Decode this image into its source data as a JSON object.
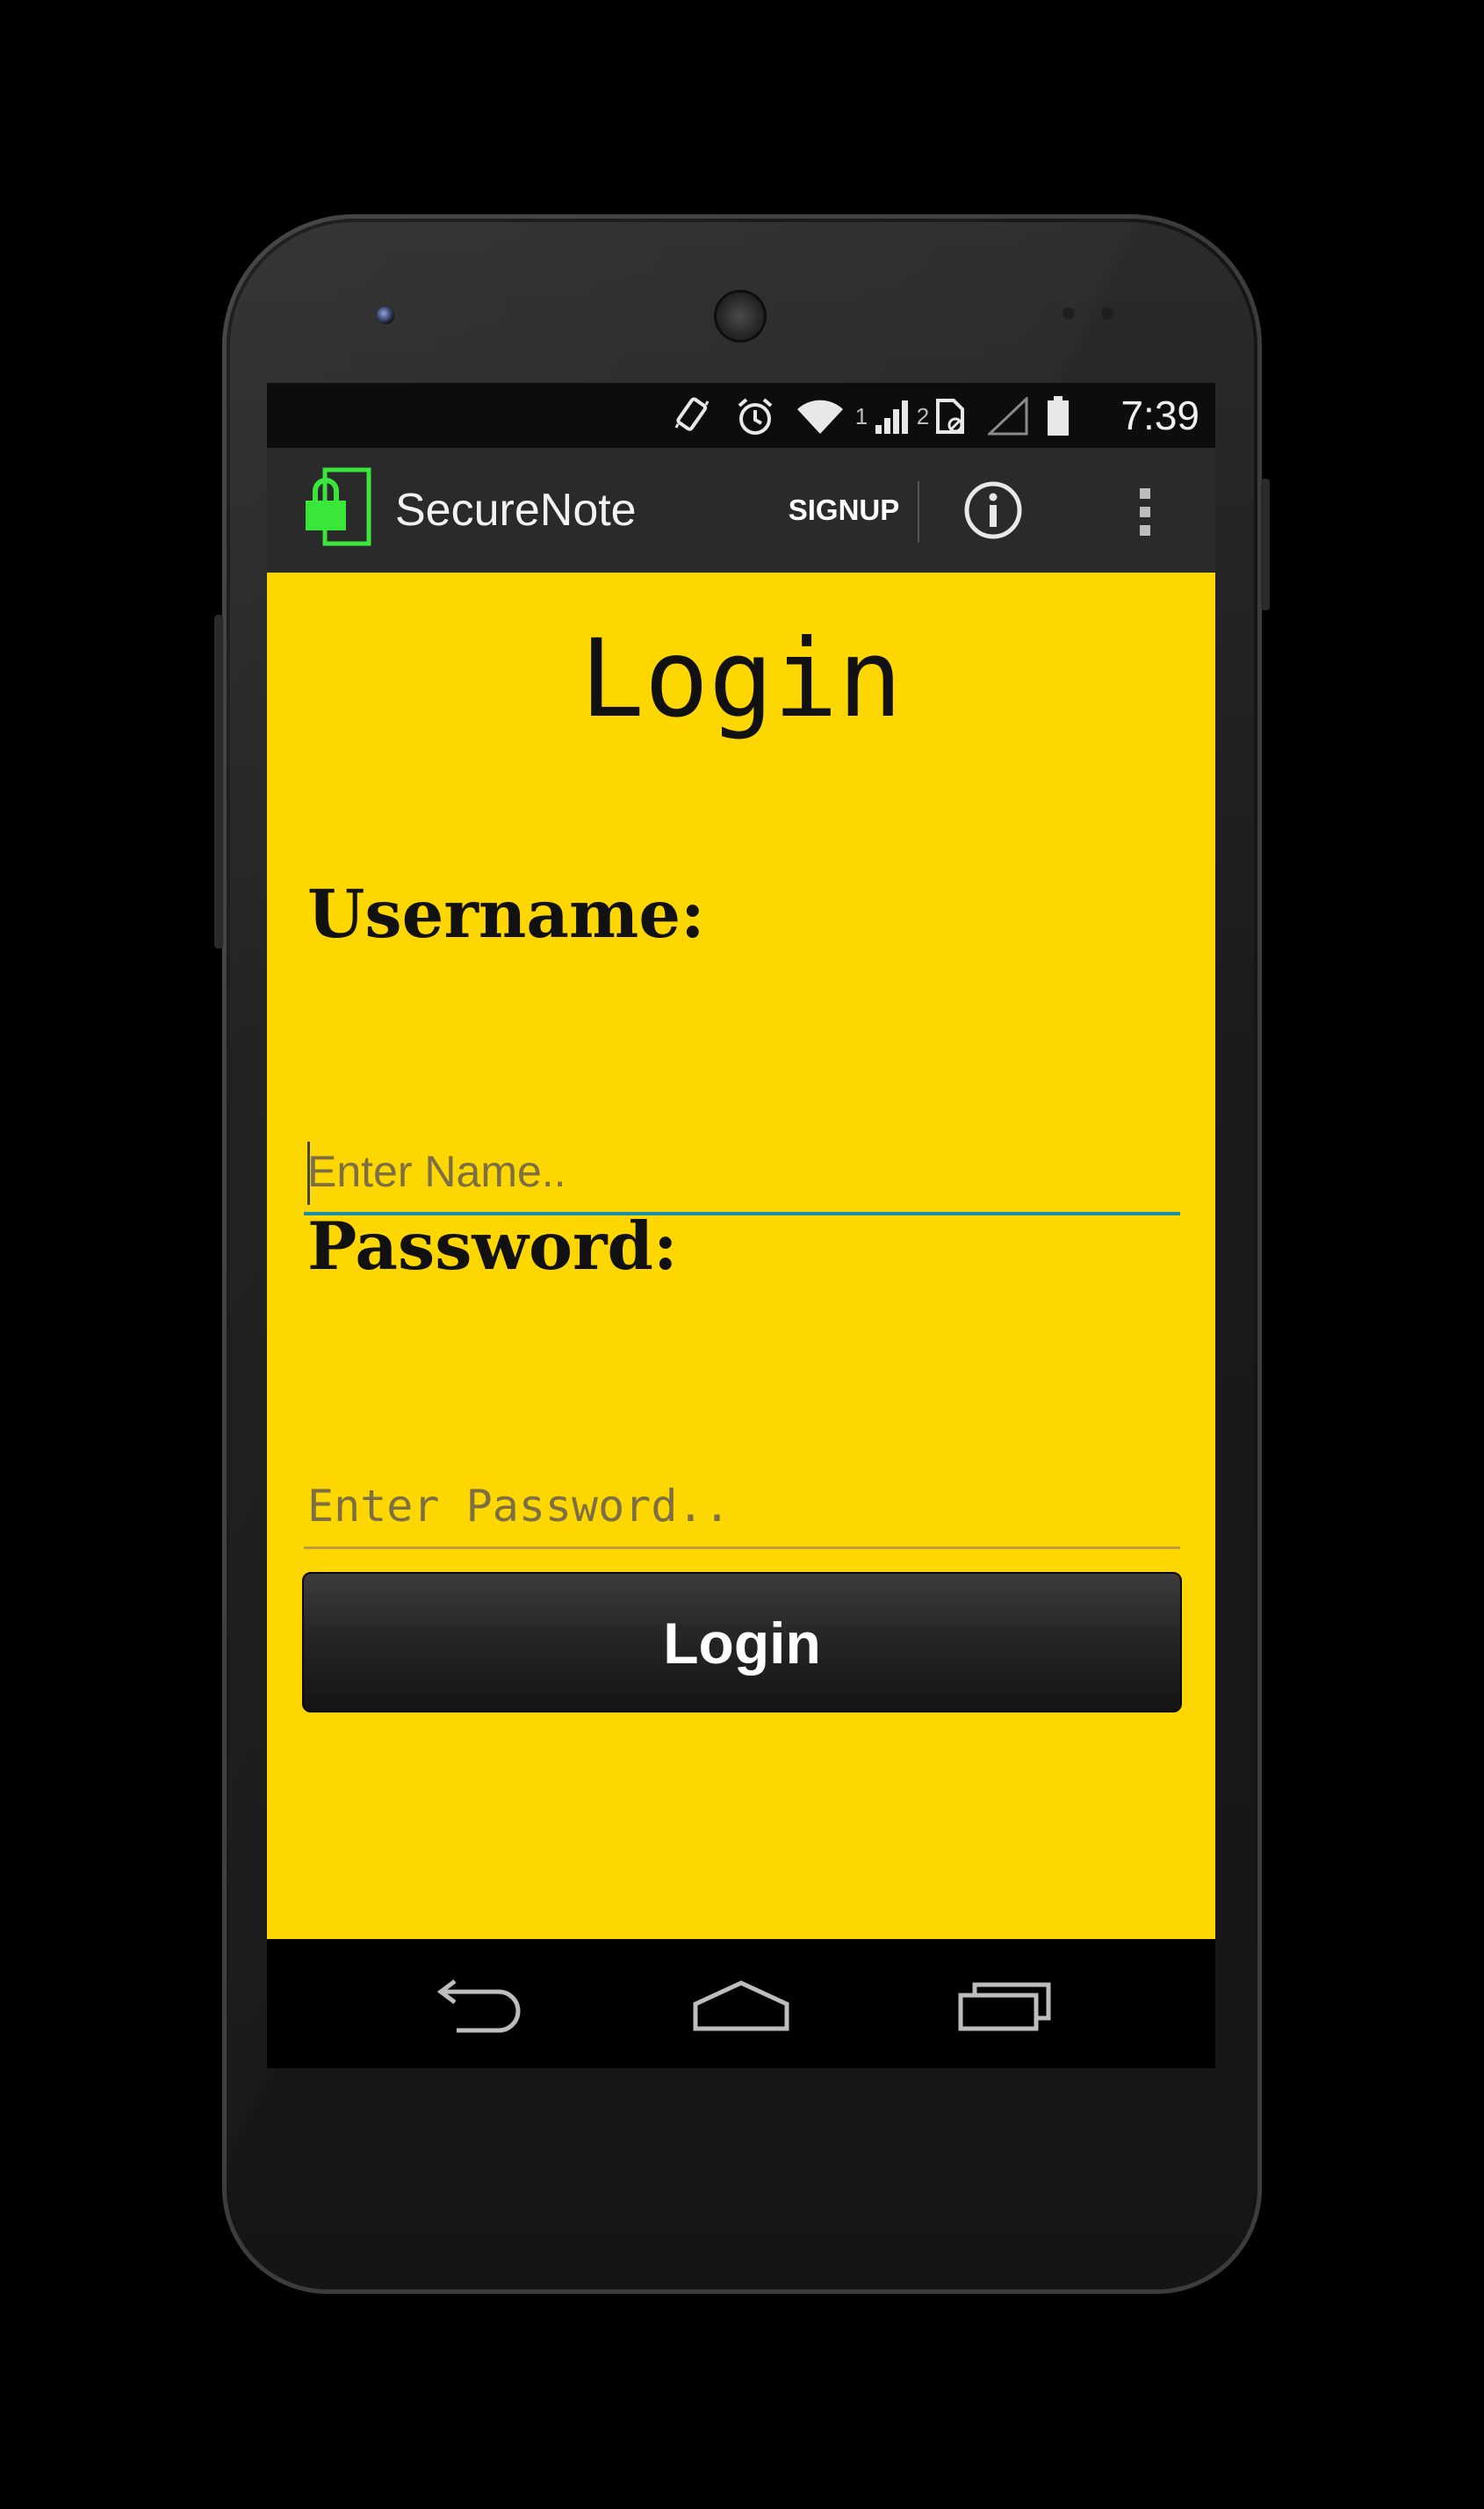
{
  "status_bar": {
    "time": "7:39",
    "icons": [
      "vibrate-icon",
      "alarm-icon",
      "wifi-icon",
      "signal-icon",
      "sim-icon",
      "battery-icon"
    ],
    "sim1_label": "1",
    "sim2_label": "2"
  },
  "action_bar": {
    "app_title": "SecureNote",
    "signup_label": "SIGNUP",
    "lock_color": "#39e639",
    "background": "#2a2a2a"
  },
  "main": {
    "title": "Login",
    "username_label": "Username:",
    "username_placeholder": "Enter Name..",
    "password_label": "Password:",
    "password_placeholder": "Enter Password..",
    "login_button_label": "Login",
    "background": "#ffd700"
  },
  "nav_bar": {
    "buttons": [
      "back-icon",
      "home-icon",
      "recent-apps-icon"
    ]
  }
}
